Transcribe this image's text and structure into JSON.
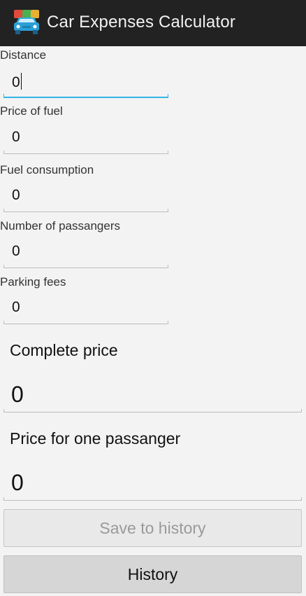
{
  "app": {
    "title": "Car Expenses Calculator",
    "icon": "car-app-icon"
  },
  "fields": {
    "distance": {
      "label": "Distance",
      "value": "0"
    },
    "fuel_price": {
      "label": "Price of fuel",
      "value": "0"
    },
    "fuel_consumption": {
      "label": "Fuel consumption",
      "value": "0"
    },
    "passengers": {
      "label": "Number of passangers",
      "value": "0"
    },
    "parking": {
      "label": "Parking fees",
      "value": "0"
    }
  },
  "results": {
    "complete": {
      "title": "Complete price",
      "value": "0"
    },
    "per_passenger": {
      "title": "Price for one passanger",
      "value": "0"
    }
  },
  "buttons": {
    "save": "Save to history",
    "history": "History"
  },
  "colors": {
    "actionbar": "#222222",
    "focus_accent": "#33b5e5",
    "background": "#f3f3f3"
  }
}
